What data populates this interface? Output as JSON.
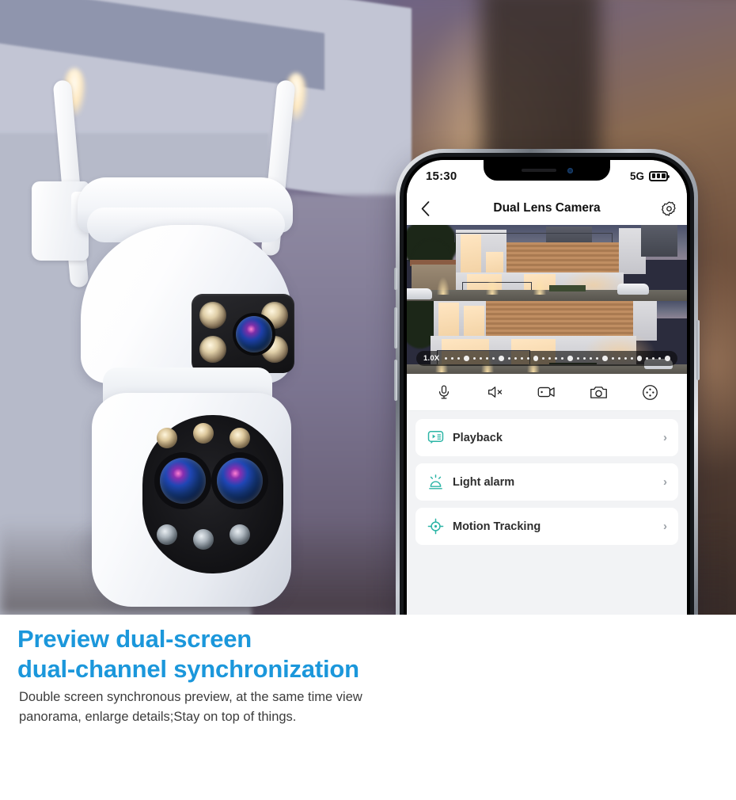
{
  "promo": {
    "headline_line1": "Preview dual-screen",
    "headline_line2": "dual-channel synchronization",
    "body": "Double screen synchronous preview, at the same time view panorama, enlarge details;Stay on top of things.",
    "accent_color": "#1b97db",
    "body_color": "#3c3c3c"
  },
  "phone": {
    "status_bar": {
      "time": "15:30",
      "network": "5G",
      "battery_icon": "battery-full-icon",
      "battery_bars": 3
    },
    "nav": {
      "back_icon": "chevron-left-icon",
      "title": "Dual Lens Camera",
      "settings_icon": "gear-icon"
    },
    "video": {
      "top_view_name": "panorama-camera-feed",
      "bottom_view_name": "detail-camera-feed",
      "zoom_label": "1.0X"
    },
    "toolbar": [
      {
        "name": "microphone-icon",
        "label": "Microphone"
      },
      {
        "name": "speaker-mute-icon",
        "label": "Mute"
      },
      {
        "name": "video-record-icon",
        "label": "Record"
      },
      {
        "name": "camera-snapshot-icon",
        "label": "Snapshot"
      },
      {
        "name": "ptz-control-icon",
        "label": "PTZ Control"
      }
    ],
    "menu": [
      {
        "label": "Playback",
        "icon": "playback-icon",
        "chevron": "›"
      },
      {
        "label": "Light alarm",
        "icon": "light-alarm-icon",
        "chevron": "›"
      },
      {
        "label": "Motion Tracking",
        "icon": "motion-tracking-icon",
        "chevron": "›"
      }
    ],
    "accent_teal": "#2cb5a6"
  },
  "product": {
    "name": "dual-lens-ptz-wifi-camera",
    "antennas": 2,
    "lens_count": 3
  }
}
